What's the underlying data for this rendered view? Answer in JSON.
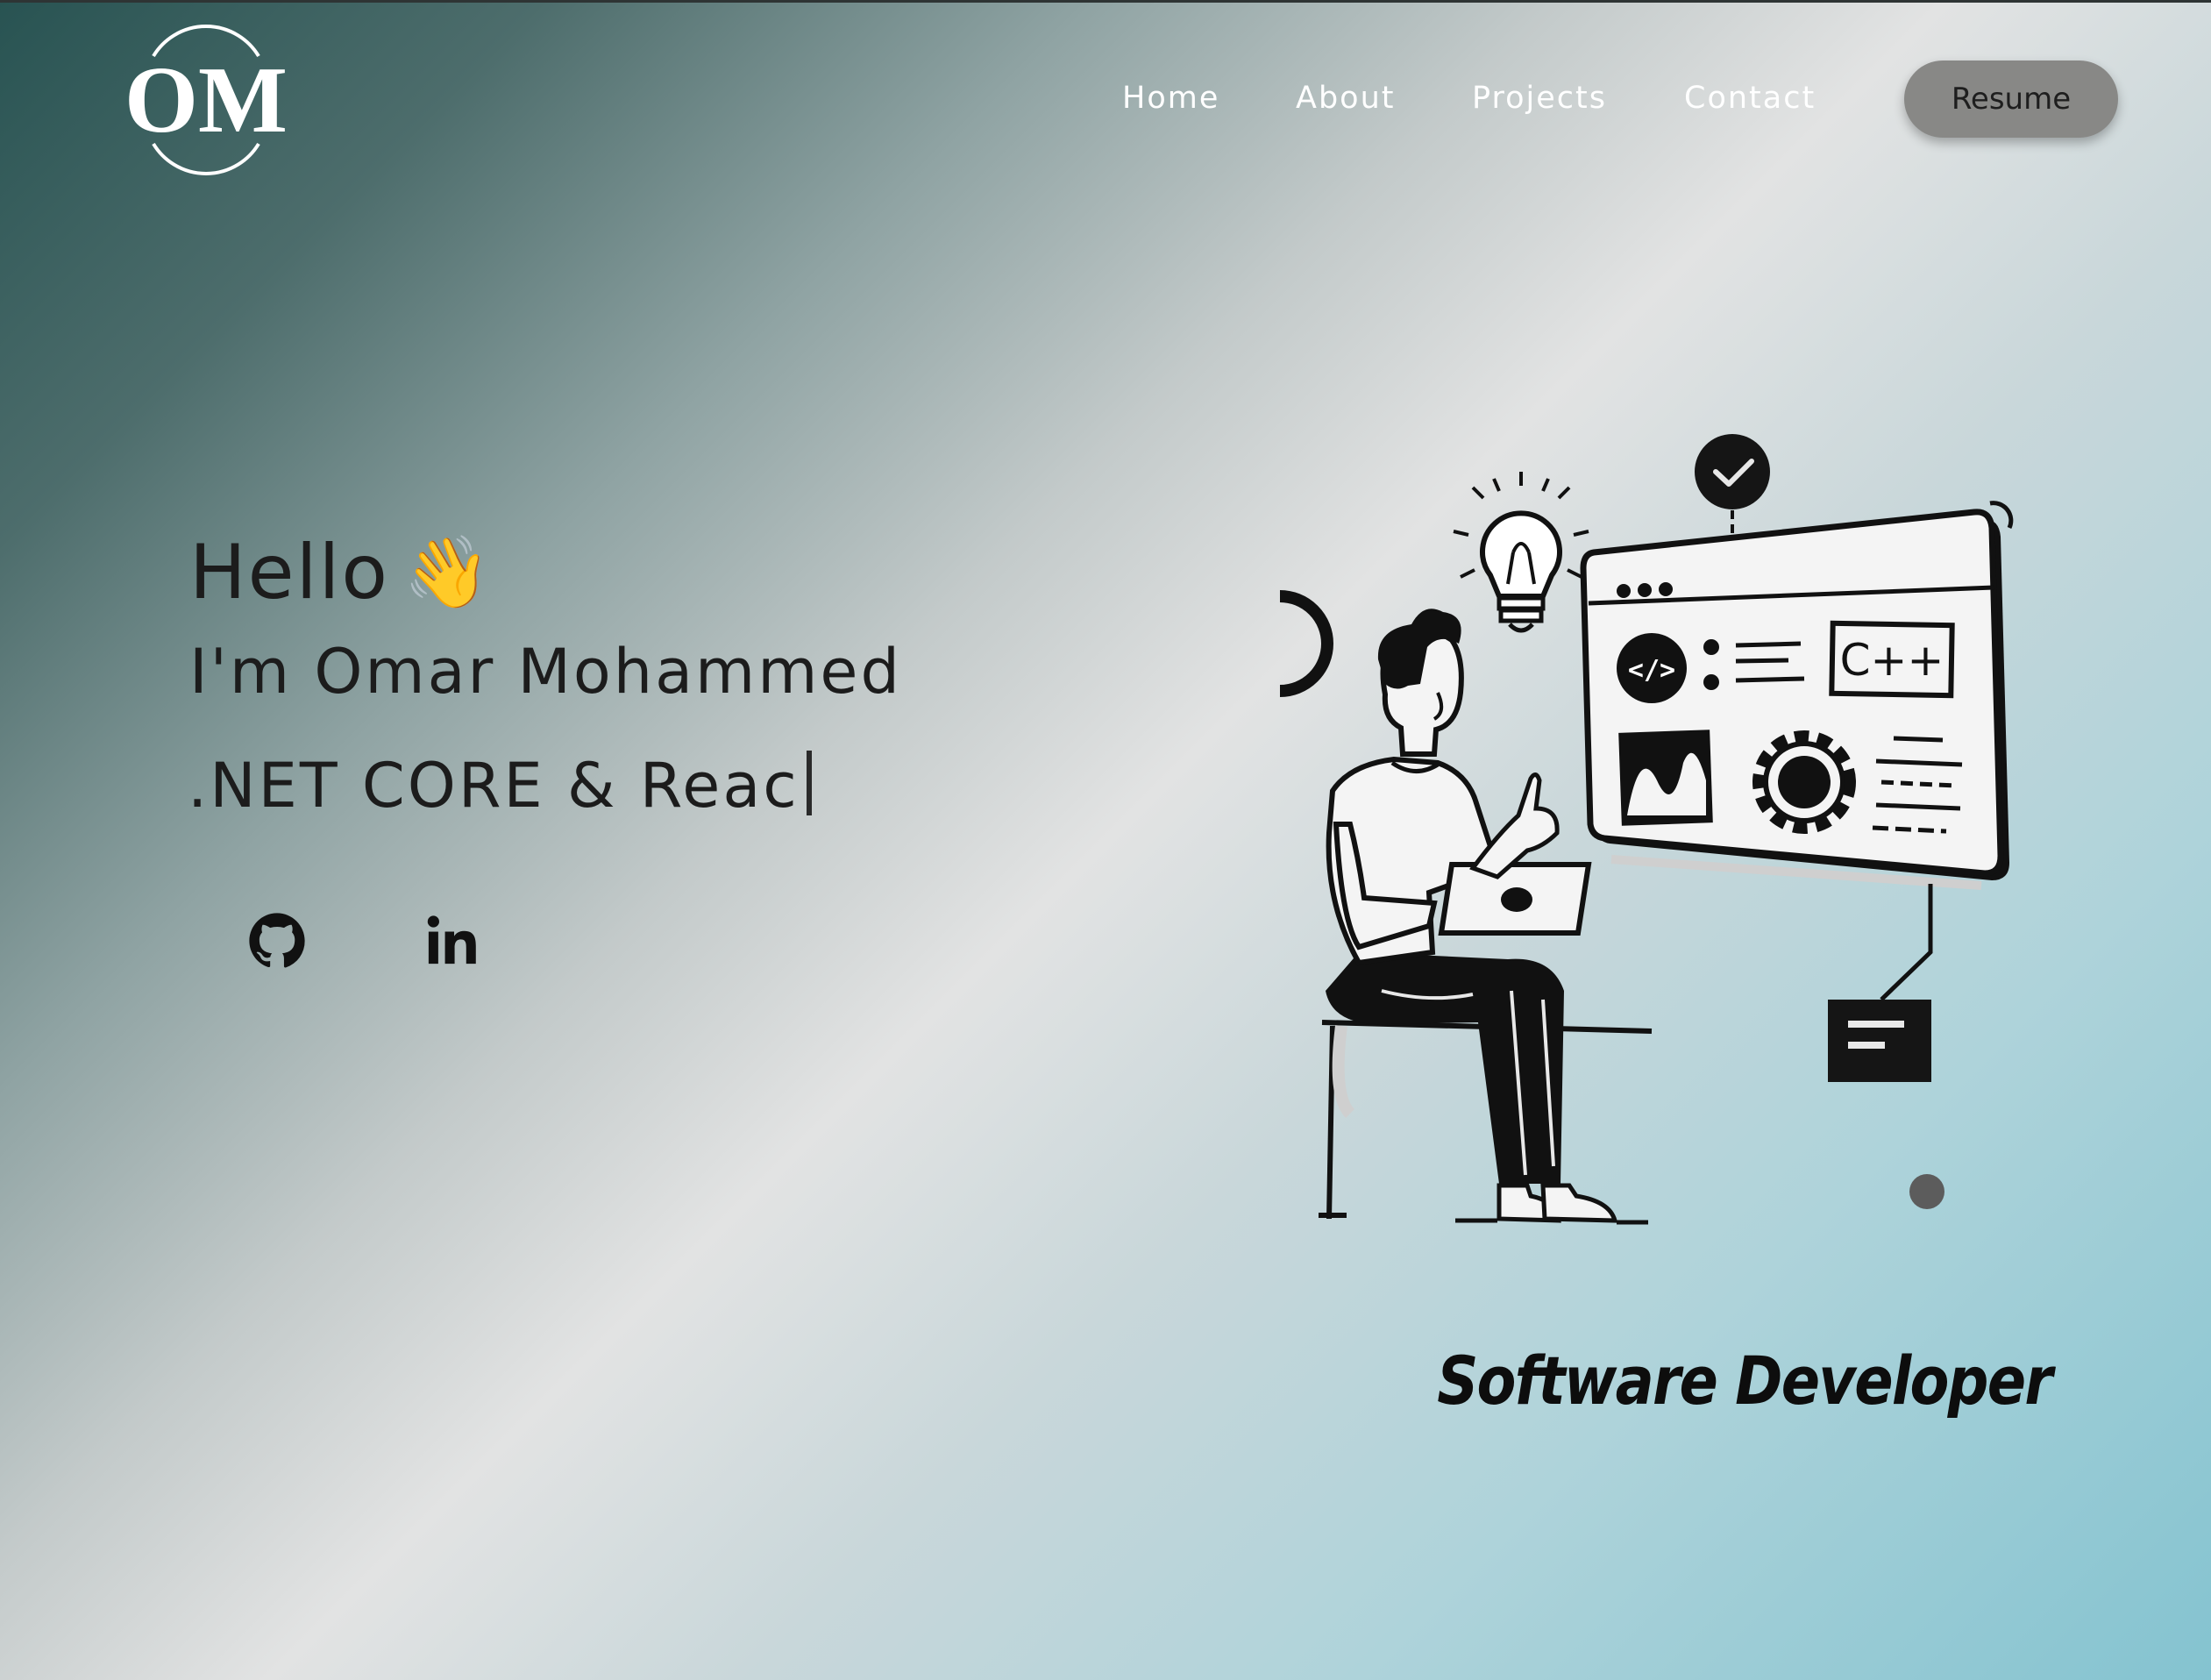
{
  "logo": {
    "text": "OM"
  },
  "nav": {
    "items": [
      {
        "label": "Home"
      },
      {
        "label": "About"
      },
      {
        "label": "Projects"
      },
      {
        "label": "Contact"
      }
    ],
    "resume_label": "Resume"
  },
  "hero": {
    "greeting": "Hello",
    "greeting_emoji": "👋",
    "name_line": "I'm Omar Mohammed",
    "typed_text": ".NET CORE & Reac"
  },
  "social": [
    {
      "icon": "github-icon"
    },
    {
      "icon": "linkedin-icon"
    }
  ],
  "illustration": {
    "screen_label": "C++",
    "code_symbol": "</>"
  },
  "role": "Software Developer"
}
